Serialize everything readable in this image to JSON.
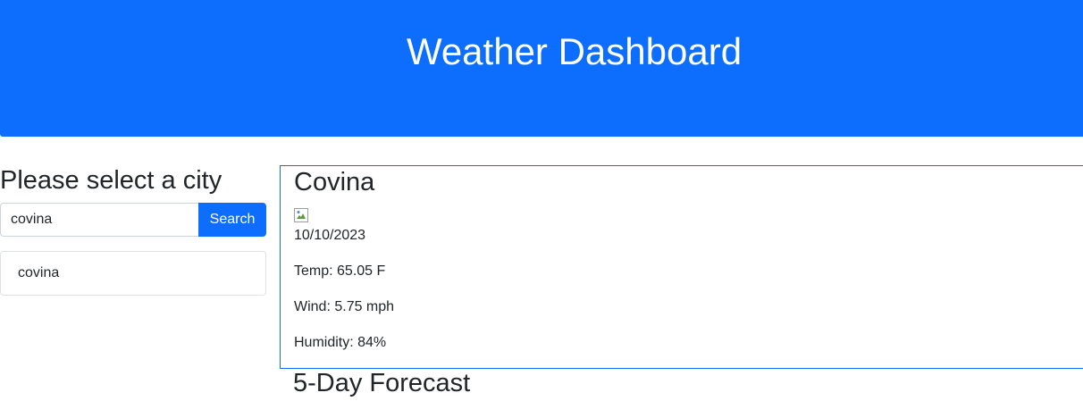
{
  "header": {
    "title": "Weather Dashboard"
  },
  "sidebar": {
    "title": "Please select a city",
    "search_value": "covina",
    "search_button_label": "Search",
    "history": [
      {
        "label": "covina"
      }
    ]
  },
  "current": {
    "city": "Covina",
    "icon": "broken-image-icon",
    "date": "10/10/2023",
    "temp": "Temp: 65.05 F",
    "wind": "Wind: 5.75 mph",
    "humidity": "Humidity: 84%"
  },
  "forecast": {
    "title": "5-Day Forecast"
  },
  "colors": {
    "primary": "#0d6efd",
    "text": "#212529",
    "border": "#dee2e6"
  }
}
